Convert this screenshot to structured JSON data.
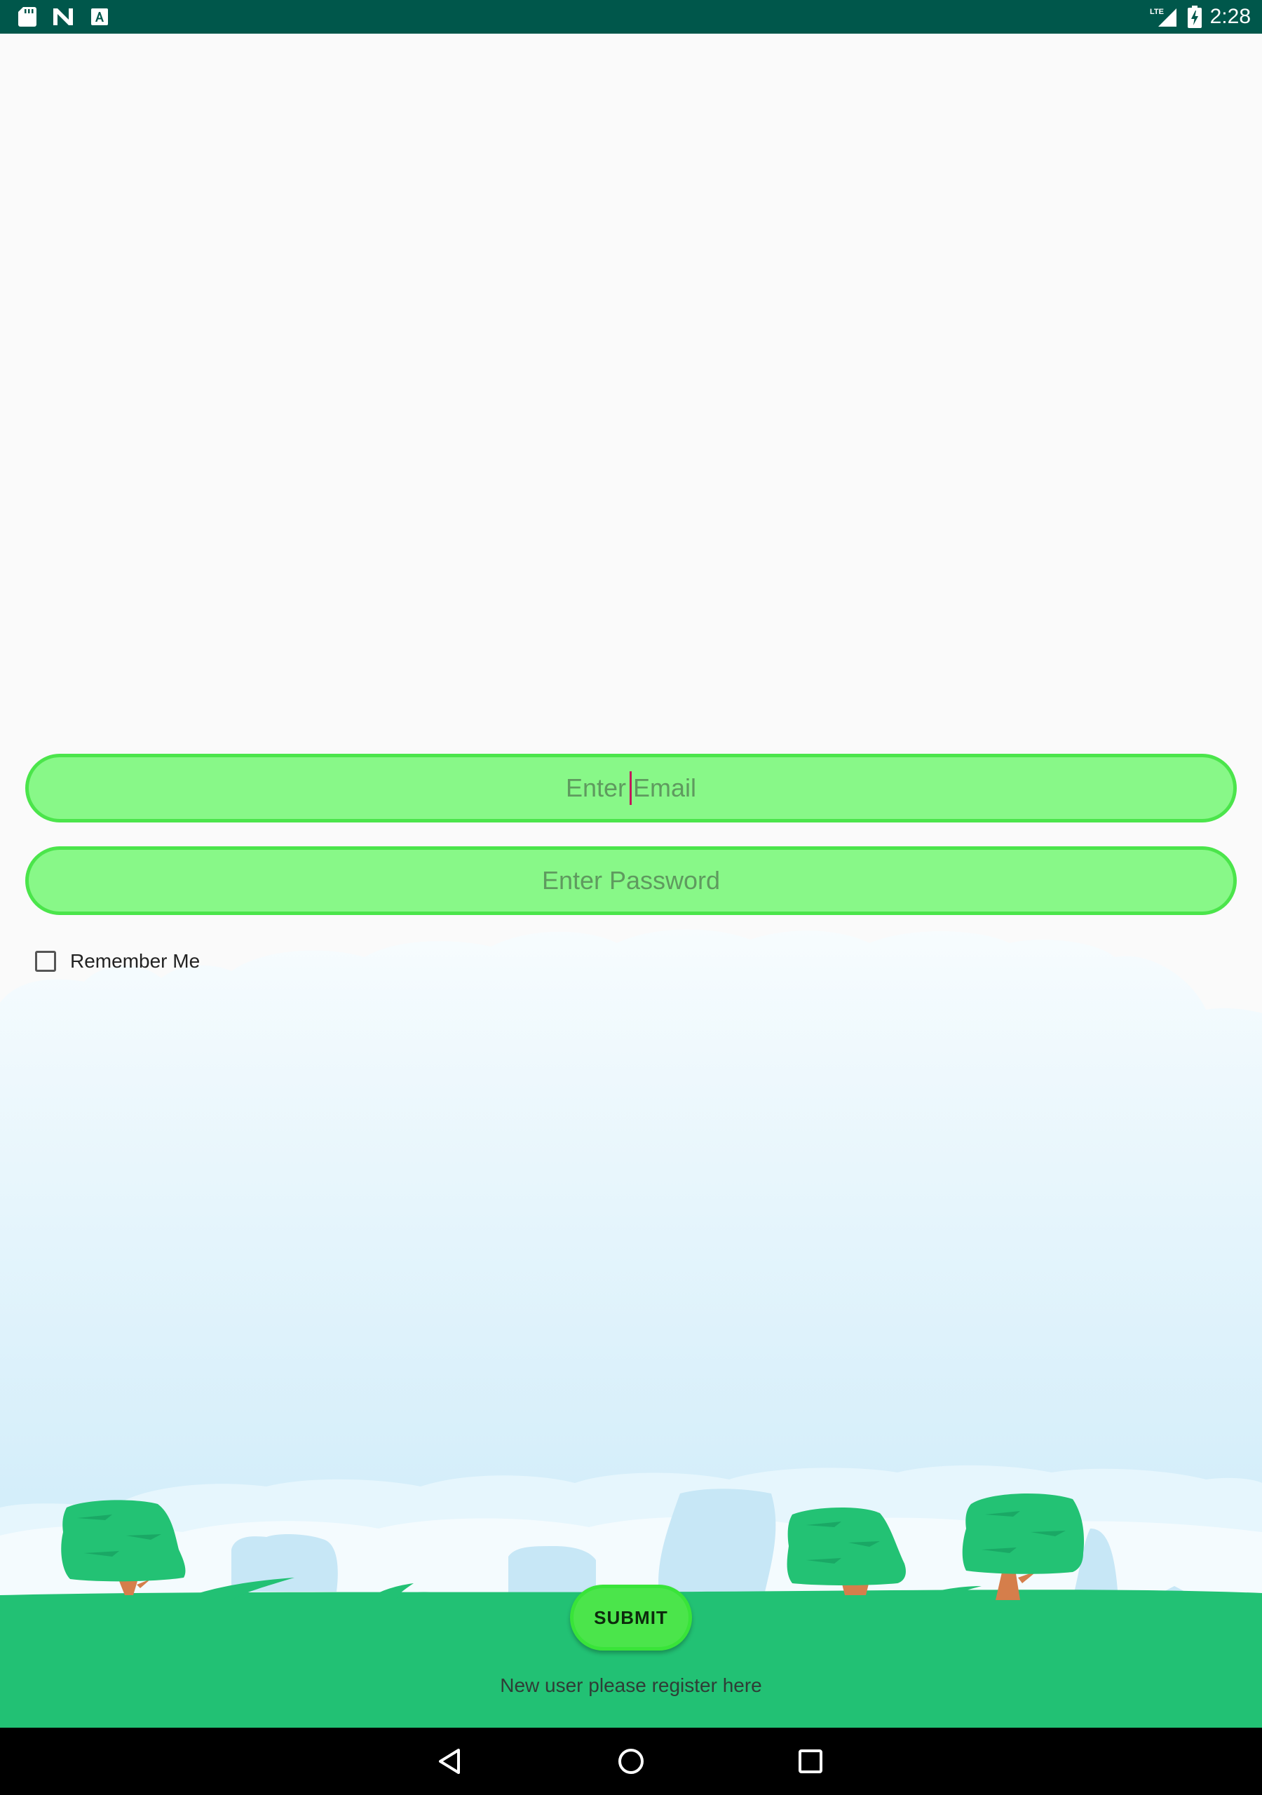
{
  "status_bar": {
    "time": "2:28",
    "network": "LTE",
    "icons": [
      "sd-card-icon",
      "n-notification-icon",
      "a-notification-icon",
      "lte-signal-icon",
      "battery-charging-icon"
    ]
  },
  "login": {
    "email_placeholder": "Enter Email",
    "email_value": "",
    "password_placeholder": "Enter Password",
    "password_value": "",
    "remember_label": "Remember Me",
    "remember_checked": false,
    "submit_label": "SUBMIT",
    "register_text": "New user please register here"
  },
  "nav_bar": {
    "buttons": [
      "back-icon",
      "home-icon",
      "recents-icon"
    ]
  },
  "colors": {
    "status_bar": "#00574b",
    "input_fill": "#88f888",
    "input_border": "#4be54b",
    "ground": "#22c174",
    "sky_top": "#fafafa",
    "sky_bottom": "#cfeefb",
    "caret": "#c2185b"
  }
}
